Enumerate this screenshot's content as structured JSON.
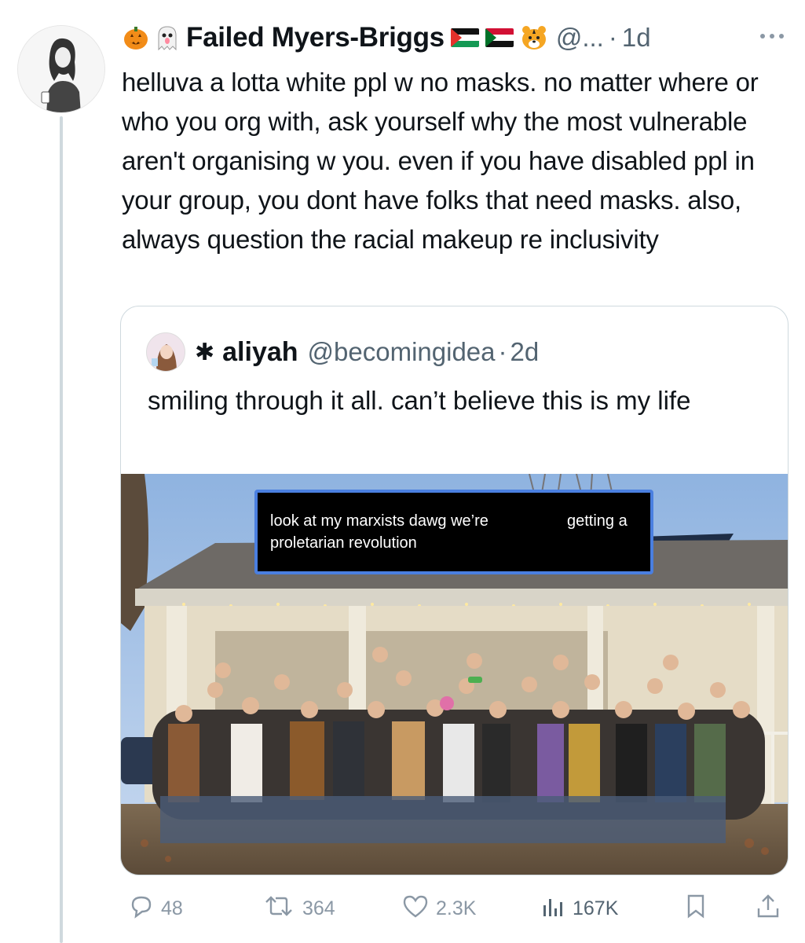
{
  "tweet": {
    "display_name": "Failed Myers-Briggs",
    "handle": "@...",
    "separator": "·",
    "time": "1d",
    "text": "helluva a lotta white ppl w no masks. no matter where or who you org with, ask yourself why the most vulnerable aren't organising w you. even if you have disabled ppl in your group, you dont have folks that need masks. also, always question the racial makeup re inclusivity",
    "name_emojis": [
      "pumpkin-icon",
      "ghost-icon"
    ],
    "name_suffix_icons": [
      "palestine-flag-icon",
      "sudan-flag-icon",
      "tiger-face-icon"
    ]
  },
  "quote": {
    "name_prefix": "✱",
    "display_name": "aliyah",
    "handle": "@becomingidea",
    "separator": "·",
    "time": "2d",
    "text": "smiling through it all. can’t believe this is my life",
    "image_caption": {
      "line1a": "look at my marxists dawg we’re",
      "line1b": "getting a",
      "line2": "proletarian revolution"
    }
  },
  "actions": {
    "replies": "48",
    "retweets": "364",
    "likes": "2.3K",
    "views": "167K"
  },
  "colors": {
    "text": "#0f1419",
    "secondary": "#536471",
    "muted_actions": "#8b98a5",
    "border": "#cfd9de",
    "caption_border": "#4a7fe0"
  }
}
